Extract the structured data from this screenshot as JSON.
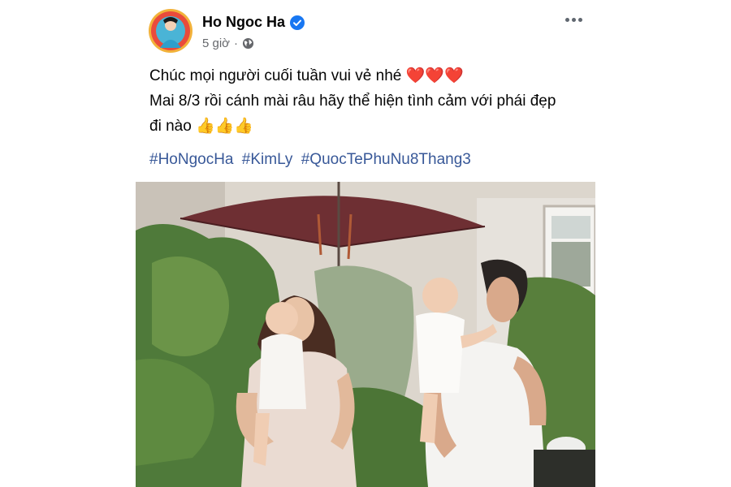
{
  "post": {
    "author": "Ho Ngoc Ha",
    "time": "5 giờ",
    "separator": "·",
    "text_lines": [
      "Chúc mọi người cuối tuần vui vẻ nhé",
      "Mai 8/3 rồi cánh mài râu hãy thể hiện tình cảm với phái đẹp",
      "đi nào"
    ],
    "line1_emoji": "❤️❤️❤️",
    "line3_emoji": "👍👍👍",
    "hashtags": [
      "#HoNgocHa",
      "#KimLy",
      "#QuocTePhuNu8Thang3"
    ]
  },
  "icons": {
    "verified": "verified-badge-icon",
    "privacy": "globe-icon",
    "more": "more-options-icon"
  },
  "colors": {
    "verified": "#1877f2",
    "hashtag": "#385898",
    "meta": "#65676b"
  }
}
